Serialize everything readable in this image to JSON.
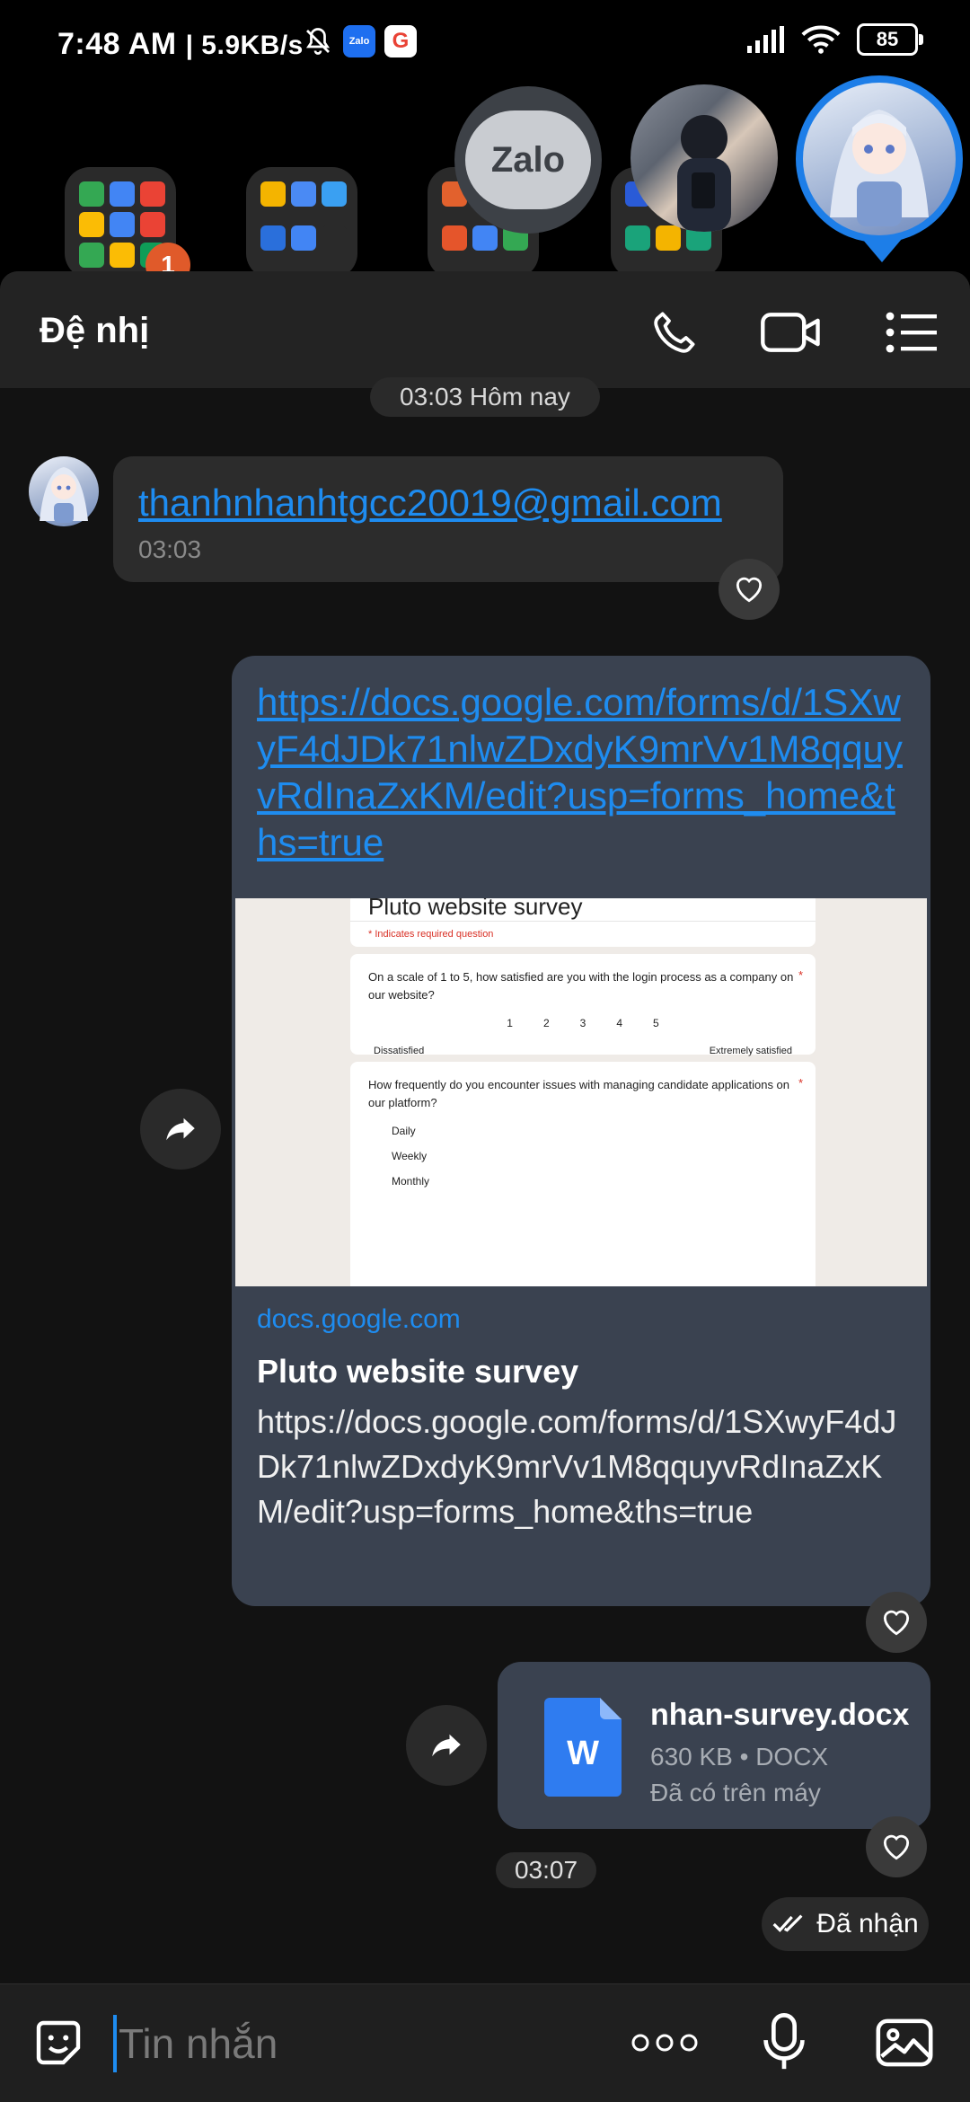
{
  "status_bar": {
    "time": "7:48 AM",
    "net_speed": "| 5.9KB/s",
    "zalo_badge": "Zalo",
    "google_badge": "G",
    "battery": "85"
  },
  "launcher": {
    "badge_count": "1"
  },
  "bubbles": {
    "zalo_label": "Zalo"
  },
  "header": {
    "title": "Đệ nhị"
  },
  "messages": {
    "date_divider": "03:03 Hôm nay",
    "incoming_email": "thanhnhanhtgcc20019@gmail.com",
    "incoming_time": "03:03",
    "link_url": "https://docs.google.com/forms/d/1SXwyF4dJDk71nlwZDxdyK9mrVv1M8qquyvRdInaZxKM/edit?usp=forms_home&ths=true",
    "link_domain": "docs.google.com",
    "link_title": "Pluto website survey",
    "link_description": "https://docs.google.com/forms/d/1SXwyF4dJDk71nlwZDxdyK9mrVv1M8qquyvRdInaZxKM/edit?usp=forms_home&ths=true",
    "file_name": "nhan-survey.docx",
    "file_meta": "630 KB • DOCX",
    "file_status": "Đã có trên máy",
    "file_time": "03:07",
    "delivered": "Đã nhận"
  },
  "preview": {
    "form_title": "Pluto website survey",
    "required_note": "* Indicates required question",
    "q1": "On a scale of 1 to 5, how satisfied are you with the login process as a company on our website?",
    "q1_star": "*",
    "scale": [
      "1",
      "2",
      "3",
      "4",
      "5"
    ],
    "scale_low": "Dissatisfied",
    "scale_high": "Extremely satisfied",
    "q2": "How frequently do you encounter issues with managing candidate applications on our platform?",
    "q2_star": "*",
    "options": [
      "Daily",
      "Weekly",
      "Monthly"
    ]
  },
  "composer": {
    "placeholder": "Tin nhắn"
  },
  "colors": {
    "accent": "#1e8cf0",
    "bubble_out": "#3a4250",
    "bubble_in": "#2c2c2c",
    "panel_bg": "#121212",
    "header_bg": "#232323"
  },
  "icons": [
    "bell-off-icon",
    "signal-icon",
    "wifi-icon",
    "phone-icon",
    "video-icon",
    "menu-icon",
    "heart-icon",
    "share-icon",
    "word-file-icon",
    "double-check-icon",
    "sticker-icon",
    "more-icon",
    "mic-icon",
    "image-icon"
  ]
}
